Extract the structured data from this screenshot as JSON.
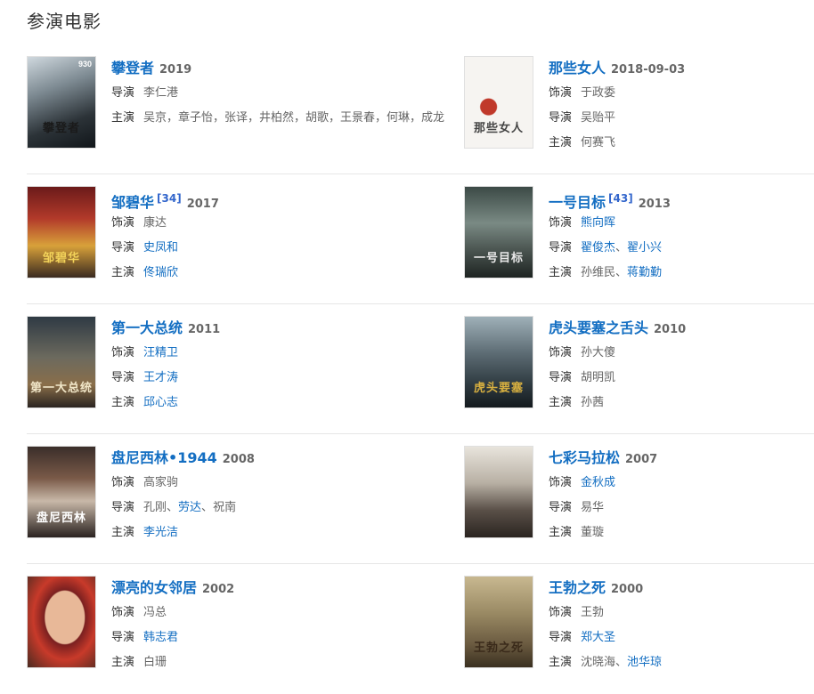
{
  "section_title": "参演电影",
  "films": [
    {
      "title": "攀登者",
      "ref": "",
      "year": "2019",
      "poster_text": "攀登者",
      "poster_badge": "930",
      "poster_bg": "linear-gradient(160deg,#cfd8de 0%,#7d8a92 35%,#2c3338 70%,#11161a 100%)",
      "poster_fg": "#1a1a1a",
      "rows": [
        {
          "label": "导演",
          "people": [
            {
              "name": "李仁港",
              "link": false
            }
          ]
        },
        {
          "label": "主演",
          "text": "吴京，章子怡，张译，井柏然，胡歌，王景春，何琳，成龙"
        }
      ]
    },
    {
      "title": "那些女人",
      "ref": "",
      "year": "2018-09-03",
      "poster_text": "那些女人",
      "poster_badge": "",
      "poster_bg": "radial-gradient(circle at 35% 55%,#c0392b 0 9px,#f6f4f1 10px),linear-gradient(#faf8f6,#eeeae6)",
      "poster_fg": "#444444",
      "rows": [
        {
          "label": "饰演",
          "people": [
            {
              "name": "于政委",
              "link": false
            }
          ]
        },
        {
          "label": "导演",
          "people": [
            {
              "name": "吴贻平",
              "link": false
            }
          ]
        },
        {
          "label": "主演",
          "people": [
            {
              "name": "何赛飞",
              "link": false
            }
          ]
        }
      ]
    },
    {
      "title": "邹碧华",
      "ref": "[34]",
      "year": "2017",
      "poster_text": "邹碧华",
      "poster_badge": "",
      "poster_bg": "linear-gradient(180deg,#6b1a1a 0%,#b23a2a 35%,#d8a13a 65%,#3a2a20 100%)",
      "poster_fg": "#f3d35a",
      "rows": [
        {
          "label": "饰演",
          "people": [
            {
              "name": "康达",
              "link": false
            }
          ]
        },
        {
          "label": "导演",
          "people": [
            {
              "name": "史凤和",
              "link": true
            }
          ]
        },
        {
          "label": "主演",
          "people": [
            {
              "name": "佟瑞欣",
              "link": true
            }
          ]
        }
      ]
    },
    {
      "title": "一号目标",
      "ref": "[43]",
      "year": "2013",
      "poster_text": "一号目标",
      "poster_badge": "",
      "poster_bg": "linear-gradient(180deg,#3c4a46 0%,#7a8a84 40%,#4a5450 70%,#1e2422 100%)",
      "poster_fg": "#e8e8e8",
      "rows": [
        {
          "label": "饰演",
          "people": [
            {
              "name": "熊向晖",
              "link": true
            }
          ]
        },
        {
          "label": "导演",
          "people": [
            {
              "name": "翟俊杰",
              "link": true
            },
            {
              "name": "翟小兴",
              "link": true
            }
          ]
        },
        {
          "label": "主演",
          "people": [
            {
              "name": "孙维民",
              "link": false
            },
            {
              "name": "蒋勤勤",
              "link": true
            }
          ]
        }
      ]
    },
    {
      "title": "第一大总统",
      "ref": "",
      "year": "2011",
      "poster_text": "第一大总统",
      "poster_badge": "",
      "poster_bg": "linear-gradient(180deg,#2f3a44 0%,#6c6a5e 45%,#8a6e4a 75%,#2a2420 100%)",
      "poster_fg": "#f0e6c8",
      "rows": [
        {
          "label": "饰演",
          "people": [
            {
              "name": "汪精卫",
              "link": true
            }
          ]
        },
        {
          "label": "导演",
          "people": [
            {
              "name": "王才涛",
              "link": true
            }
          ]
        },
        {
          "label": "主演",
          "people": [
            {
              "name": "邱心志",
              "link": true
            }
          ]
        }
      ]
    },
    {
      "title": "虎头要塞之舌头",
      "ref": "",
      "year": "2010",
      "poster_text": "虎头要塞",
      "poster_badge": "",
      "poster_bg": "linear-gradient(180deg,#9fb0b8 0%,#5d6c74 40%,#2e3a40 75%,#141a1e 100%)",
      "poster_fg": "#d8b040",
      "rows": [
        {
          "label": "饰演",
          "people": [
            {
              "name": "孙大傻",
              "link": false
            }
          ]
        },
        {
          "label": "导演",
          "people": [
            {
              "name": "胡明凯",
              "link": false
            }
          ]
        },
        {
          "label": "主演",
          "people": [
            {
              "name": "孙茜",
              "link": false
            }
          ]
        }
      ]
    },
    {
      "title": "盘尼西林•1944",
      "ref": "",
      "year": "2008",
      "poster_text": "盘尼西林",
      "poster_badge": "",
      "poster_bg": "linear-gradient(180deg,#3a2e2a 0%,#7a5a48 35%,#c8b8a8 60%,#2a2220 100%)",
      "poster_fg": "#ffffff",
      "rows": [
        {
          "label": "饰演",
          "people": [
            {
              "name": "高家驹",
              "link": false
            }
          ]
        },
        {
          "label": "导演",
          "people": [
            {
              "name": "孔刚",
              "link": false
            },
            {
              "name": "劳达",
              "link": true
            },
            {
              "name": "祝南",
              "link": false
            }
          ]
        },
        {
          "label": "主演",
          "people": [
            {
              "name": "李光洁",
              "link": true
            }
          ]
        }
      ]
    },
    {
      "title": "七彩马拉松",
      "ref": "",
      "year": "2007",
      "poster_text": "",
      "poster_badge": "",
      "poster_bg": "linear-gradient(180deg,#e8e4dc 0%,#b8b0a4 40%,#5a5048 70%,#2a2420 100%)",
      "poster_fg": "#ffffff",
      "rows": [
        {
          "label": "饰演",
          "people": [
            {
              "name": "金秋成",
              "link": true
            }
          ]
        },
        {
          "label": "导演",
          "people": [
            {
              "name": "易华",
              "link": false
            }
          ]
        },
        {
          "label": "主演",
          "people": [
            {
              "name": "董璇",
              "link": false
            }
          ]
        }
      ]
    },
    {
      "title": "漂亮的女邻居",
      "ref": "",
      "year": "2002",
      "poster_text": "",
      "poster_badge": "",
      "poster_bg": "radial-gradient(ellipse at 55% 45%,#e8b898 0 22px,#7a2020 23px,#c83a2a 60%,#4a2a20 100%)",
      "poster_fg": "#ffffff",
      "rows": [
        {
          "label": "饰演",
          "people": [
            {
              "name": "冯总",
              "link": false
            }
          ]
        },
        {
          "label": "导演",
          "people": [
            {
              "name": "韩志君",
              "link": true
            }
          ]
        },
        {
          "label": "主演",
          "people": [
            {
              "name": "白珊",
              "link": false
            }
          ]
        }
      ]
    },
    {
      "title": "王勃之死",
      "ref": "",
      "year": "2000",
      "poster_text": "王勃之死",
      "poster_badge": "",
      "poster_bg": "linear-gradient(180deg,#c8b890 0%,#9a8a64 40%,#6a5a40 75%,#3a3020 100%)",
      "poster_fg": "#3a2a1a",
      "rows": [
        {
          "label": "饰演",
          "people": [
            {
              "name": "王勃",
              "link": false
            }
          ]
        },
        {
          "label": "导演",
          "people": [
            {
              "name": "郑大圣",
              "link": true
            }
          ]
        },
        {
          "label": "主演",
          "people": [
            {
              "name": "沈晓海",
              "link": false
            },
            {
              "name": "池华琼",
              "link": true
            }
          ]
        }
      ]
    }
  ]
}
